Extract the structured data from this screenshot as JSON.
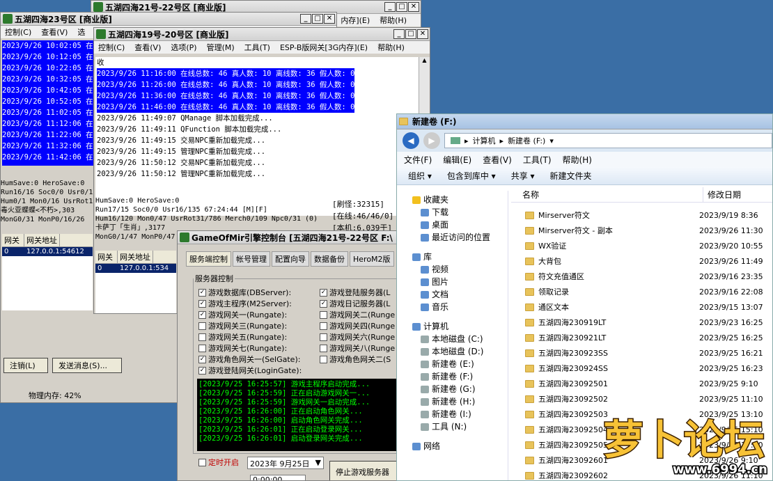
{
  "win23": {
    "title": "五湖四海23号区 [商业版]",
    "menu": [
      "控制(C)",
      "查看(V)",
      "选"
    ],
    "log": [
      "2023/9/26 10:02:05 在",
      "2023/9/26 10:12:05 在",
      "2023/9/26 10:22:05 在",
      "2023/9/26 10:32:05 在",
      "2023/9/26 10:42:05 在",
      "2023/9/26 10:52:05 在",
      "2023/9/26 11:02:05 在",
      "2023/9/26 11:12:06 在",
      "2023/9/26 11:22:06 在",
      "2023/9/26 11:32:06 在",
      "2023/9/26 11:42:06 在"
    ],
    "status": [
      "HumSave:0 HeroSave:0",
      "Run16/16 Soc0/0 Usr0/1",
      "Hum0/1 Mon0/16 UsrRot1",
      "毒火亚蝶蝶<不朽>,303",
      "MonG0/31 MonP0/16/26"
    ],
    "grid_cols": [
      "网关",
      "网关地址"
    ],
    "grid_row": [
      "0",
      "127.0.0.1:54612"
    ],
    "logout": "注销(L)",
    "send": "发送消息(S)...",
    "memory": "物理内存: 42%"
  },
  "win21": {
    "title": "五湖四海21号-22号区 [商业版]",
    "menu_tail": [
      "内存](E)",
      "帮助(H)"
    ]
  },
  "win19": {
    "title": "五湖四海19号-20号区 [商业版]",
    "menu": [
      "控制(C)",
      "查看(V)",
      "选项(P)",
      "管理(M)",
      "工具(T)",
      "ESP-B版网关[3G内存](E)",
      "帮助(H)"
    ],
    "first": "收",
    "hl": [
      "2023/9/26 11:16:00 在线总数: 46 真人数: 10 离线数: 36 假人数: 0",
      "2023/9/26 11:26:00 在线总数: 46 真人数: 10 离线数: 36 假人数: 0",
      "2023/9/26 11:36:00 在线总数: 46 真人数: 10 离线数: 36 假人数: 0",
      "2023/9/26 11:46:00 在线总数: 46 真人数: 10 离线数: 36 假人数: 0"
    ],
    "plain": [
      "2023/9/26 11:49:07 QManage 脚本加载完成...",
      "2023/9/26 11:49:11 QFunction 脚本加载完成...",
      "2023/9/26 11:49:15 交易NPC重新加载完成...",
      "2023/9/26 11:49:15 管理NPC重新加载完成...",
      "2023/9/26 11:50:12 交易NPC重新加载完成...",
      "2023/9/26 11:50:12 管理NPC重新加载完成..."
    ],
    "status": [
      "HumSave:0 HeroSave:0",
      "Run17/15 Soc0/0 Usr16/135         67:24:44 [M][F]",
      "Hum16/120 Mon0/47 UsrRot31/786 Merch0/109 Npc0/31 (0)",
      "卡萨丁「生肖」,3177",
      "MonG0/1/47 MonP0/47"
    ],
    "right": [
      "[刷怪:32315]",
      "[在线:46/46/0]",
      "[本机:6.039于]"
    ],
    "grid_cols": [
      "网关",
      "网关地址"
    ],
    "grid_row": [
      "0",
      "127.0.0.1:534"
    ]
  },
  "ctrl": {
    "title": "GameOfMir引擎控制台 [五湖四海21号-22号区 F:\\",
    "tabs": [
      "服务端控制",
      "帐号管理",
      "配置向导",
      "数据备份",
      "HeroM2版"
    ],
    "group": "服务器控制",
    "left": [
      [
        "✓",
        "游戏数据库(DBServer):"
      ],
      [
        "✓",
        "游戏主程序(M2Server):"
      ],
      [
        "✓",
        "游戏网关一(Rungate):"
      ],
      [
        "",
        "游戏网关三(Rungate):"
      ],
      [
        "",
        "游戏网关五(Rungate):"
      ],
      [
        "",
        "游戏网关七(Rungate):"
      ],
      [
        "✓",
        "游戏角色网关一(SelGate):"
      ],
      [
        "✓",
        "游戏登陆网关(LoginGate):"
      ]
    ],
    "right": [
      [
        "✓",
        "游戏登陆服务器(L"
      ],
      [
        "✓",
        "游戏日记服务器(L"
      ],
      [
        "",
        "游戏网关二(Runge"
      ],
      [
        "",
        "游戏网关四(Runge"
      ],
      [
        "",
        "游戏网关六(Runge"
      ],
      [
        "",
        "游戏网关八(Runge"
      ],
      [
        "",
        "游戏角色网关二(S"
      ]
    ],
    "log": [
      "[2023/9/25 16:25:57] 游戏主程序启动完成...",
      "[2023/9/25 16:25:59] 正在启动游戏网关一...",
      "[2023/9/25 16:25:59] 游戏网关一启动完成...",
      "[2023/9/25 16:26:00] 正在启动角色网关...",
      "[2023/9/25 16:26:00] 启动角色网关完成...",
      "[2023/9/25 16:26:01] 正在启动登录网关...",
      "[2023/9/25 16:26:01] 启动登录网关完成..."
    ],
    "timer": "定时开启",
    "date": "2023年 9月25日",
    "time": "0:00:00",
    "stop": "停止游戏服务器"
  },
  "explorer": {
    "title": "新建卷 (F:)",
    "crumbs": [
      "计算机",
      "新建卷 (F:)"
    ],
    "menu": [
      "文件(F)",
      "编辑(E)",
      "查看(V)",
      "工具(T)",
      "帮助(H)"
    ],
    "toolbar": [
      "组织",
      "包含到库中",
      "共享",
      "新建文件夹"
    ],
    "nav": [
      {
        "t": "收藏夹",
        "i": "star-icon",
        "l": 0
      },
      {
        "t": "下载",
        "i": "download-icon",
        "l": 1
      },
      {
        "t": "桌面",
        "i": "desktop-icon",
        "l": 1
      },
      {
        "t": "最近访问的位置",
        "i": "recent-icon",
        "l": 1
      },
      {
        "t": "",
        "i": "",
        "l": 0
      },
      {
        "t": "库",
        "i": "library-icon",
        "l": 0
      },
      {
        "t": "视频",
        "i": "video-icon",
        "l": 1
      },
      {
        "t": "图片",
        "i": "picture-icon",
        "l": 1
      },
      {
        "t": "文档",
        "i": "document-icon",
        "l": 1
      },
      {
        "t": "音乐",
        "i": "music-icon",
        "l": 1
      },
      {
        "t": "",
        "i": "",
        "l": 0
      },
      {
        "t": "计算机",
        "i": "computer-icon",
        "l": 0
      },
      {
        "t": "本地磁盘 (C:)",
        "i": "disk-icon",
        "l": 1
      },
      {
        "t": "本地磁盘 (D:)",
        "i": "disk-icon",
        "l": 1
      },
      {
        "t": "新建卷 (E:)",
        "i": "disk-icon",
        "l": 1
      },
      {
        "t": "新建卷 (F:)",
        "i": "disk-icon",
        "l": 1
      },
      {
        "t": "新建卷 (G:)",
        "i": "disk-icon",
        "l": 1
      },
      {
        "t": "新建卷 (H:)",
        "i": "disk-icon",
        "l": 1
      },
      {
        "t": "新建卷 (I:)",
        "i": "disk-icon",
        "l": 1
      },
      {
        "t": "工具 (N:)",
        "i": "disk-icon",
        "l": 1
      },
      {
        "t": "",
        "i": "",
        "l": 0
      },
      {
        "t": "网络",
        "i": "network-icon",
        "l": 0
      }
    ],
    "cols": [
      "名称",
      "修改日期"
    ],
    "files": [
      [
        "Mirserver符文",
        "2023/9/19 8:36"
      ],
      [
        "Mirserver符文 - 副本",
        "2023/9/26 11:30"
      ],
      [
        "WX验证",
        "2023/9/20 10:55"
      ],
      [
        "大背包",
        "2023/9/26 11:49"
      ],
      [
        "符文充值通区",
        "2023/9/16 23:35"
      ],
      [
        "领取记录",
        "2023/9/16 22:08"
      ],
      [
        "通区文本",
        "2023/9/15 13:07"
      ],
      [
        "五湖四海230919LT",
        "2023/9/23 16:25"
      ],
      [
        "五湖四海230921LT",
        "2023/9/25 16:25"
      ],
      [
        "五湖四海230923SS",
        "2023/9/25 16:21"
      ],
      [
        "五湖四海230924SS",
        "2023/9/25 16:23"
      ],
      [
        "五湖四海23092501",
        "2023/9/25 9:10"
      ],
      [
        "五湖四海23092502",
        "2023/9/25 11:10"
      ],
      [
        "五湖四海23092503",
        "2023/9/25 13:10"
      ],
      [
        "五湖四海23092504",
        "2023/9/25 15:10"
      ],
      [
        "五湖四海23092505",
        "2023/9/25 17:10"
      ],
      [
        "五湖四海23092601",
        "2023/9/26 9:10"
      ],
      [
        "五湖四海23092602",
        "2023/9/26 11:10"
      ]
    ]
  },
  "watermark": {
    "logo": "萝卜论坛",
    "url": "www.6994.cn"
  }
}
